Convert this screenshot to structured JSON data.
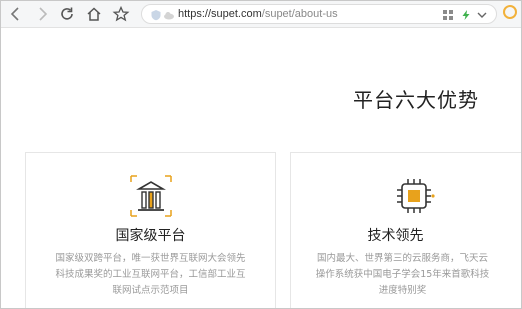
{
  "browser": {
    "url_host": "https://supet.com",
    "url_path": "/supet/about-us",
    "icons": {
      "back": "back-arrow-icon",
      "forward": "forward-arrow-icon",
      "reload": "reload-icon",
      "home": "home-icon",
      "bookmark": "star-icon",
      "grid": "grid-icon",
      "flash": "lightning-icon",
      "menu": "chevron-down-icon",
      "extension": "extension-icon"
    }
  },
  "section": {
    "title": "平台六大优势"
  },
  "cards": [
    {
      "title": "国家级平台",
      "desc": "国家级双跨平台，唯一获世界互联网大会领先科技成果奖的工业互联网平台，工信部工业互联网试点示范项目",
      "icon": "bank-building-icon"
    },
    {
      "title": "技术领先",
      "desc": "国内最大、世界第三的云服务商，飞天云操作系统获中国电子学会15年来首歌科技进度特别奖",
      "icon": "chip-icon"
    }
  ],
  "colors": {
    "accent": "#e8a21c",
    "icon_dark": "#333333",
    "text_gray": "#999999"
  }
}
